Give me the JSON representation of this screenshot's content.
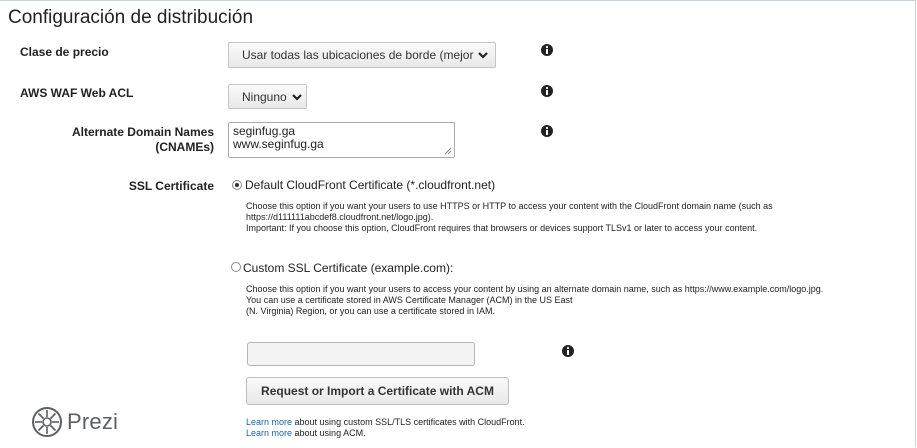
{
  "section_title": "Configuración de distribución",
  "price_class": {
    "label": "Clase de precio",
    "value": "Usar todas las ubicaciones de borde (mejor"
  },
  "waf": {
    "label": "AWS WAF Web ACL",
    "value": "Ninguno"
  },
  "cnames": {
    "label_line1": "Alternate Domain Names",
    "label_line2": "(CNAMEs)",
    "line1": "seginfug.ga",
    "line2": "www.seginfug.ga"
  },
  "ssl": {
    "label": "SSL Certificate",
    "default_option": {
      "label": "Default CloudFront Certificate (*.cloudfront.net)",
      "selected": true,
      "desc_line1": "Choose this option if you want your users to use HTTPS or HTTP to access your content with the CloudFront domain name (such as",
      "desc_line2": "https://d111111abcdef8.cloudfront.net/logo.jpg).",
      "desc_line3": "Important: If you choose this option, CloudFront requires that browsers or devices support TLSv1 or later to access your content."
    },
    "custom_option": {
      "label": "Custom SSL Certificate (example.com):",
      "selected": false,
      "desc_line1": "Choose this option if you want your users to access your content by using an alternate domain name, such as https://www.example.com/logo.jpg.",
      "desc_line2": "You can use a certificate stored in AWS Certificate Manager (ACM) in the US East",
      "desc_line3": "(N. Virginia) Region, or you can use a certificate stored in IAM."
    },
    "certificate_input_value": "",
    "request_button": "Request or Import a Certificate with ACM",
    "learn_more_1_link": "Learn more",
    "learn_more_1_text": " about using custom SSL/TLS certificates with CloudFront.",
    "learn_more_2_link": "Learn more",
    "learn_more_2_text": " about using ACM."
  },
  "watermark": "Prezi",
  "icons": {
    "info": "info-icon",
    "dropdown": "chevron-down-icon",
    "prezi_logo": "prezi-logo-icon"
  },
  "colors": {
    "link": "#1166bb",
    "title": "#222222",
    "prezi": "#5c5f63"
  }
}
